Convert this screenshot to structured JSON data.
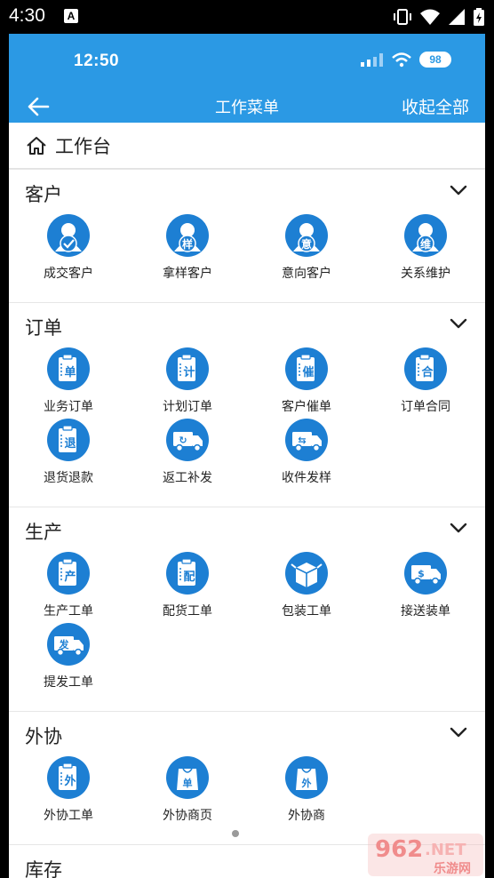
{
  "system": {
    "time": "4:30",
    "notif": "A"
  },
  "app_status": {
    "time": "12:50",
    "battery": "98"
  },
  "header": {
    "title": "工作菜单",
    "collapse_label": "收起全部"
  },
  "workbench": {
    "label": "工作台"
  },
  "sections": [
    {
      "title": "客户",
      "items": [
        {
          "label": "成交客户",
          "icon": "person-check-icon",
          "glyph": ""
        },
        {
          "label": "拿样客户",
          "icon": "person-sample-icon",
          "glyph": "样"
        },
        {
          "label": "意向客户",
          "icon": "person-intent-icon",
          "glyph": "意"
        },
        {
          "label": "关系维护",
          "icon": "person-maintain-icon",
          "glyph": "维"
        }
      ]
    },
    {
      "title": "订单",
      "items": [
        {
          "label": "业务订单",
          "icon": "clipboard-order-icon",
          "glyph": "单"
        },
        {
          "label": "计划订单",
          "icon": "clipboard-plan-icon",
          "glyph": "计"
        },
        {
          "label": "客户催单",
          "icon": "clipboard-urge-icon",
          "glyph": "催"
        },
        {
          "label": "订单合同",
          "icon": "clipboard-contract-icon",
          "glyph": "合"
        },
        {
          "label": "退货退款",
          "icon": "clipboard-return-icon",
          "glyph": "退"
        },
        {
          "label": "返工补发",
          "icon": "truck-rework-icon",
          "glyph": "↻"
        },
        {
          "label": "收件发样",
          "icon": "truck-sample-icon",
          "glyph": "⇆"
        }
      ]
    },
    {
      "title": "生产",
      "items": [
        {
          "label": "生产工单",
          "icon": "clipboard-produce-icon",
          "glyph": "产"
        },
        {
          "label": "配货工单",
          "icon": "clipboard-allocate-icon",
          "glyph": "配"
        },
        {
          "label": "包装工单",
          "icon": "box-pack-icon",
          "glyph": ""
        },
        {
          "label": "接送装单",
          "icon": "truck-shuttle-icon",
          "glyph": "$"
        },
        {
          "label": "提发工单",
          "icon": "truck-dispatch-icon",
          "glyph": "发"
        }
      ]
    },
    {
      "title": "外协",
      "items": [
        {
          "label": "外协工单",
          "icon": "clipboard-outsource-icon",
          "glyph": "外"
        },
        {
          "label": "外协商页",
          "icon": "bag-outsource-page-icon",
          "glyph": "单"
        },
        {
          "label": "外协商",
          "icon": "bag-outsource-icon",
          "glyph": "外"
        }
      ]
    },
    {
      "title": "库存",
      "items": []
    }
  ],
  "watermark": {
    "text_num": "962",
    "text_net": ".NET",
    "text_cn": "乐游网"
  },
  "colors": {
    "primary": "#2b99e4",
    "icon": "#1d7fd3"
  }
}
